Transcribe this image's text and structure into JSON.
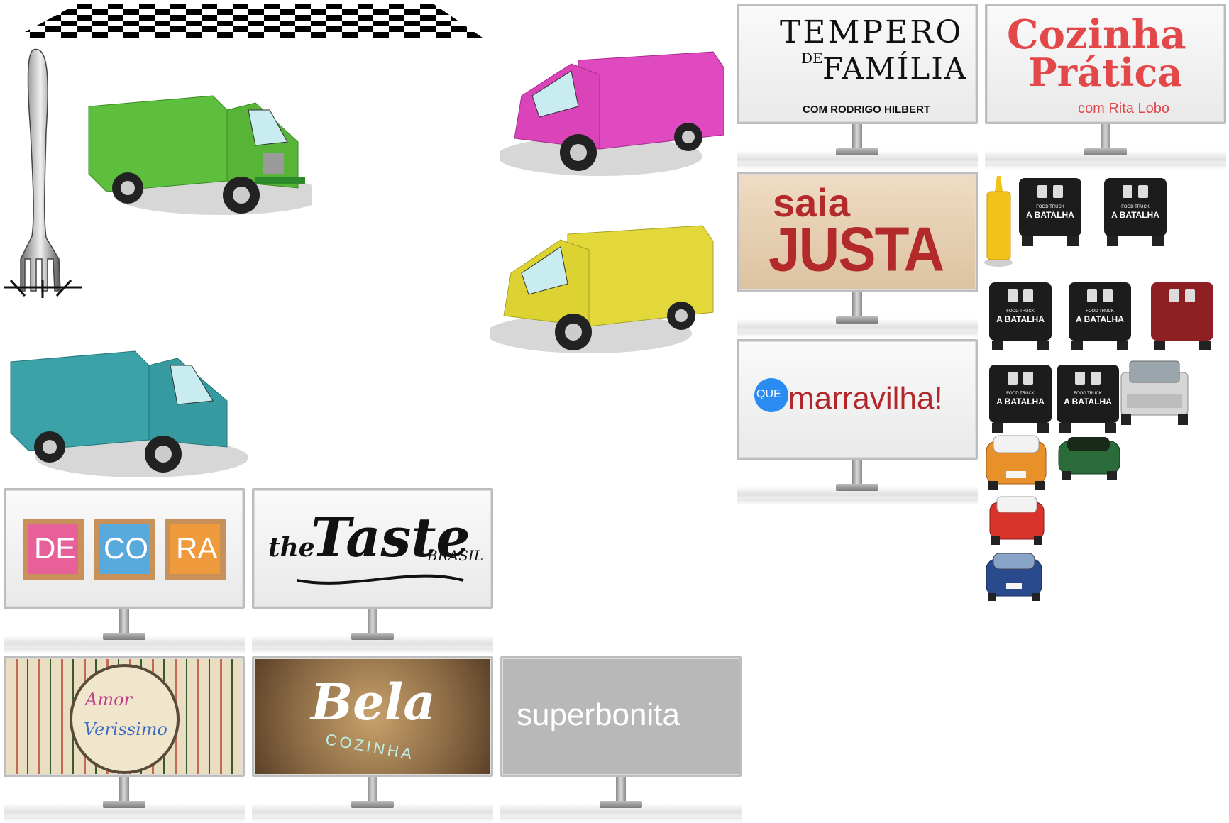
{
  "canvas": {
    "background": "#ffffff"
  },
  "billboards": {
    "tempero": {
      "line1": "TEMPERO",
      "line2a": "DE",
      "line2b": "FAMÍLIA",
      "byline": "COM RODRIGO HILBERT"
    },
    "cozinha": {
      "line1": "Cozinha",
      "line2": "Prática",
      "byline": "com  Rita Lobo",
      "color": "#e2484a"
    },
    "saia": {
      "line1": "saia",
      "line2": "JUSTA",
      "color": "#b22a2a"
    },
    "marravilha": {
      "badge": "QUE",
      "text": "marravilha!",
      "badge_color": "#2a8cf0",
      "text_color": "#b3262a"
    },
    "decora": {
      "tiles": [
        "DE",
        "CO",
        "RA"
      ],
      "colors": [
        "#e8609a",
        "#58a9dc",
        "#ef9a3c"
      ]
    },
    "taste": {
      "the": "the",
      "taste": "Taste",
      "brasil": "BRASIL"
    },
    "amor": {
      "line1": "Amor",
      "line2": "Verissimo"
    },
    "bela": {
      "bela": "Bela",
      "cozinha": "COZINHA"
    },
    "superbonita": {
      "text": "superbonita",
      "bg": "#b8b8b8"
    }
  },
  "food_trucks": {
    "colors": {
      "green": "#5dbf3d",
      "magenta": "#e04ac0",
      "yellow": "#e2d83a",
      "teal": "#3ba2a8"
    }
  },
  "rear_trucks": {
    "label_small": "FOOD TRUCK",
    "label_big": "A BATALHA",
    "color": "#1c1c1c",
    "red_color": "#8e1f22"
  },
  "cars": {
    "orange": "#e8912a",
    "green": "#2a6b3a",
    "red": "#d8342c",
    "blue": "#2a4a8e",
    "pickup": "#d6d6d6"
  },
  "props": {
    "mustard": "#f0c21a"
  }
}
